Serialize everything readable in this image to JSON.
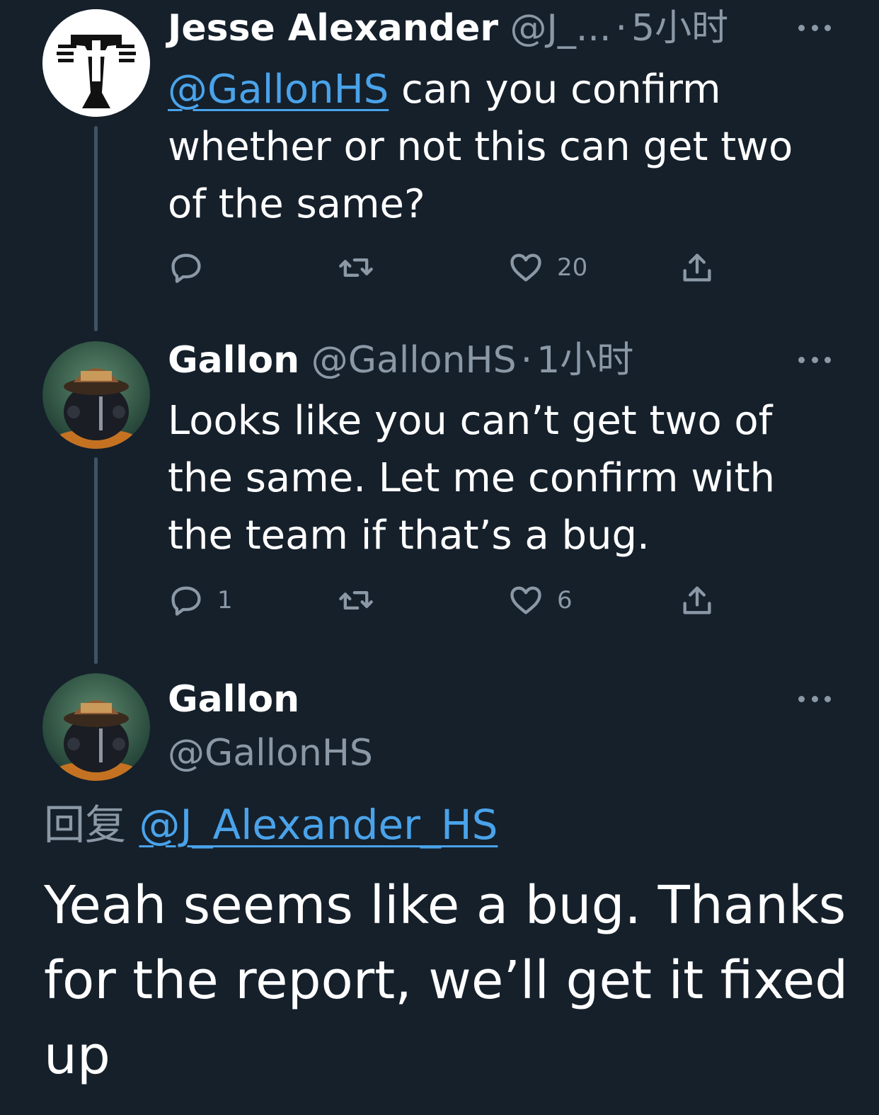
{
  "tweets": [
    {
      "author_name": "Jesse Alexander",
      "handle": "@J_...",
      "separator": "·",
      "time": "5小时",
      "mention": "@GallonHS",
      "text": " can you confirm whether or not this can get two of the same?",
      "reply_count": "",
      "like_count": "20"
    },
    {
      "author_name": "Gallon",
      "handle": "@GallonHS",
      "separator": "·",
      "time": "1小时",
      "text": "Looks like you can’t get two of the same. Let me confirm with the team if that’s a bug.",
      "reply_count": "1",
      "like_count": "6"
    }
  ],
  "main_tweet": {
    "author_name": "Gallon",
    "handle": "@GallonHS",
    "reply_prefix": "回复",
    "reply_to": "@J_Alexander_HS",
    "text": "Yeah seems like a bug. Thanks for the report, we’ll get it fixed up"
  },
  "icons": [
    "reply-icon",
    "retweet-icon",
    "like-icon",
    "share-icon",
    "more-icon"
  ],
  "colors": {
    "background": "#15202b",
    "text": "#ffffff",
    "muted": "#8b98a5",
    "link": "#4aa3ea"
  }
}
